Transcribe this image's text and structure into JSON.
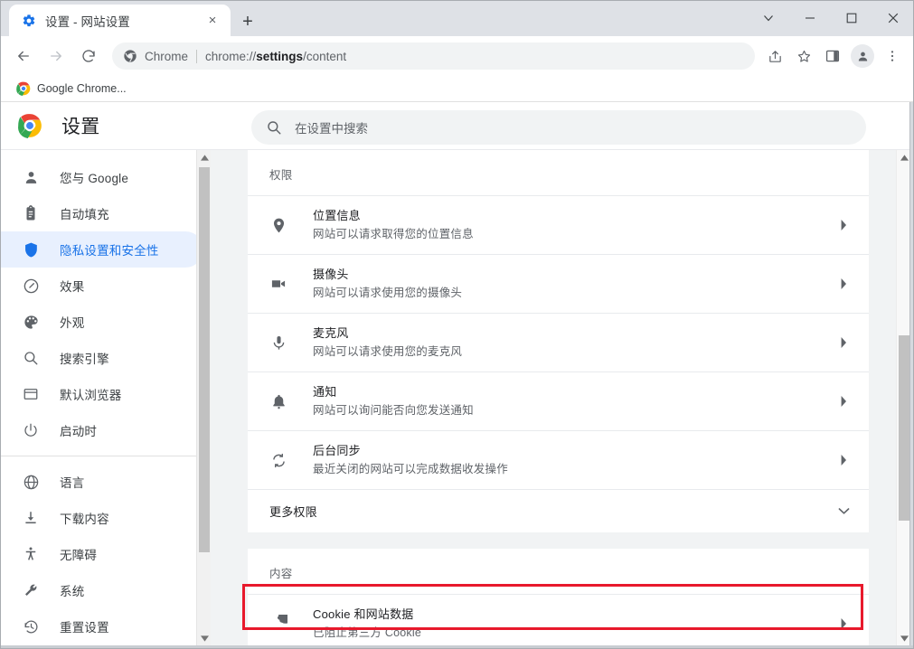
{
  "window": {
    "tab": {
      "title": "设置 - 网站设置",
      "favicon": "gear-icon",
      "close": "×"
    },
    "new_tab": "+",
    "controls": {
      "minimize": "−",
      "maximize": "□",
      "close": "✕",
      "tab_search": "⌄"
    }
  },
  "toolbar": {
    "back": "←",
    "forward": "→",
    "reload": "⟳",
    "omnibox": {
      "chip": "Chrome",
      "url_prefix": "chrome://",
      "url_bold": "settings",
      "url_suffix": "/content"
    },
    "share": "share-icon",
    "bookmark": "star-icon",
    "side_panel": "side-panel-icon",
    "profile": "avatar-icon",
    "menu": "three-dot-icon"
  },
  "bookmarks_bar": {
    "items": [
      {
        "label": "Google Chrome...",
        "icon": "chrome-icon"
      }
    ]
  },
  "settings": {
    "title": "设置",
    "search": {
      "placeholder": "在设置中搜索",
      "icon": "search-icon"
    },
    "sidebar": {
      "groups": [
        {
          "items": [
            {
              "label": "您与 Google",
              "icon": "person-icon",
              "active": false
            },
            {
              "label": "自动填充",
              "icon": "clipboard-icon",
              "active": false
            },
            {
              "label": "隐私设置和安全性",
              "icon": "shield-icon",
              "active": true
            },
            {
              "label": "效果",
              "icon": "speedometer-icon",
              "active": false
            },
            {
              "label": "外观",
              "icon": "palette-icon",
              "active": false
            },
            {
              "label": "搜索引擎",
              "icon": "search-icon",
              "active": false
            },
            {
              "label": "默认浏览器",
              "icon": "browser-window-icon",
              "active": false
            },
            {
              "label": "启动时",
              "icon": "power-icon",
              "active": false
            }
          ]
        },
        {
          "items": [
            {
              "label": "语言",
              "icon": "globe-icon",
              "active": false
            },
            {
              "label": "下载内容",
              "icon": "download-icon",
              "active": false
            },
            {
              "label": "无障碍",
              "icon": "accessibility-icon",
              "active": false
            },
            {
              "label": "系统",
              "icon": "wrench-icon",
              "active": false
            },
            {
              "label": "重置设置",
              "icon": "history-restore-icon",
              "active": false
            }
          ]
        }
      ]
    },
    "main": {
      "permissions_section": {
        "heading": "权限",
        "rows": [
          {
            "title": "位置信息",
            "subtitle": "网站可以请求取得您的位置信息",
            "icon": "location-pin-icon",
            "arrow": "chevron-right-icon"
          },
          {
            "title": "摄像头",
            "subtitle": "网站可以请求使用您的摄像头",
            "icon": "video-camera-icon",
            "arrow": "chevron-right-icon"
          },
          {
            "title": "麦克风",
            "subtitle": "网站可以请求使用您的麦克风",
            "icon": "microphone-icon",
            "arrow": "chevron-right-icon"
          },
          {
            "title": "通知",
            "subtitle": "网站可以询问能否向您发送通知",
            "icon": "bell-icon",
            "arrow": "chevron-right-icon"
          },
          {
            "title": "后台同步",
            "subtitle": "最近关闭的网站可以完成数据收发操作",
            "icon": "sync-icon",
            "arrow": "chevron-right-icon"
          }
        ],
        "expander": {
          "label": "更多权限",
          "arrow": "chevron-down-icon",
          "highlighted": true
        }
      },
      "content_section": {
        "heading": "内容",
        "rows": [
          {
            "title": "Cookie 和网站数据",
            "subtitle": "已阻止第三方 Cookie",
            "icon": "cookie-icon",
            "arrow": "chevron-right-icon"
          }
        ]
      }
    }
  },
  "colors": {
    "accent": "#1a73e8",
    "accent_bg": "#e8f0fe",
    "highlight_box": "#e8192c",
    "text_primary": "#202124",
    "text_secondary": "#5f6368",
    "page_bg": "#f1f3f4",
    "card_bg": "#ffffff"
  }
}
